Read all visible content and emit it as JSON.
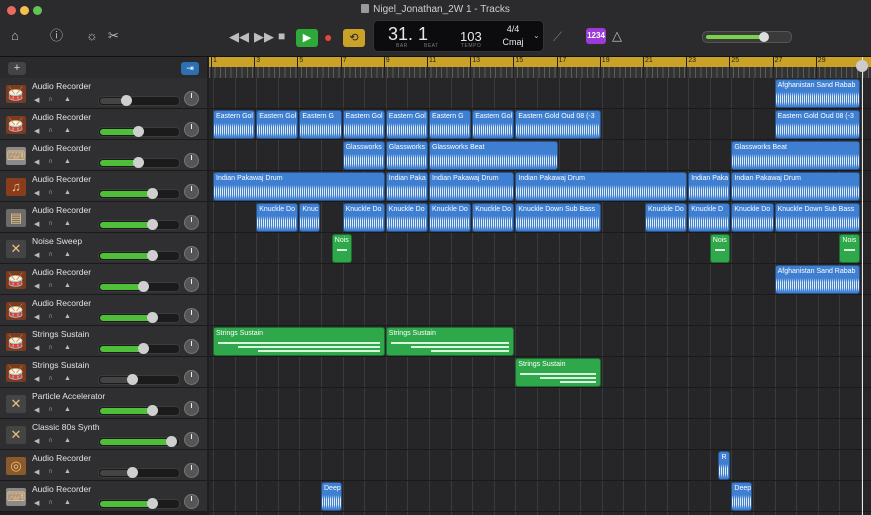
{
  "window": {
    "title": "Nigel_Jonathan_2W 1 - Tracks"
  },
  "toolbar": {
    "lcd": {
      "position": "31. 1",
      "bar_caption": "BAR",
      "beat_caption": "BEAT",
      "tempo": "103",
      "tempo_caption": "TEMPO",
      "time_signature": "4/4",
      "key": "Cmaj"
    },
    "count_in_badge": "1234"
  },
  "track_header": {
    "add_label": "+"
  },
  "ruler": {
    "bars": [
      "1",
      "3",
      "5",
      "7",
      "9",
      "11",
      "13",
      "15",
      "17",
      "19",
      "21",
      "23",
      "25",
      "27",
      "29"
    ]
  },
  "tracks": [
    {
      "name": "Audio Recorder",
      "icon": "drum-kit-icon",
      "volume": 0.35
    },
    {
      "name": "Audio Recorder",
      "icon": "drum-kit-icon",
      "volume": 0.5
    },
    {
      "name": "Audio Recorder",
      "icon": "keyboard-icon",
      "volume": 0.5
    },
    {
      "name": "Audio Recorder",
      "icon": "hand-drum-icon",
      "volume": 0.68
    },
    {
      "name": "Audio Recorder",
      "icon": "synth-keyboard-icon",
      "volume": 0.68
    },
    {
      "name": "Noise Sweep",
      "icon": "synth-stand-icon",
      "volume": 0.68
    },
    {
      "name": "Audio Recorder",
      "icon": "drum-kit-icon",
      "volume": 0.57
    },
    {
      "name": "Audio Recorder",
      "icon": "drum-kit-icon",
      "volume": 0.68
    },
    {
      "name": "Strings Sustain",
      "icon": "drum-kit-icon",
      "volume": 0.57
    },
    {
      "name": "Strings Sustain",
      "icon": "drum-kit-icon",
      "volume": 0.42
    },
    {
      "name": "Particle Accelerator",
      "icon": "synth-stand-icon",
      "volume": 0.68
    },
    {
      "name": "Classic 80s Synth",
      "icon": "synth-stand-icon",
      "volume": 0.92
    },
    {
      "name": "Audio Recorder",
      "icon": "snare-drum-icon",
      "volume": 0.42
    },
    {
      "name": "Audio Recorder",
      "icon": "keyboard-icon",
      "volume": 0.68
    }
  ],
  "regions": [
    {
      "row": 0,
      "start": 27,
      "end": 31,
      "type": "blue",
      "label": "Afghanistan Sand Rabab"
    },
    {
      "row": 1,
      "start": 1,
      "end": 3,
      "type": "blue",
      "label": "Eastern Gol"
    },
    {
      "row": 1,
      "start": 3,
      "end": 5,
      "type": "blue",
      "label": "Eastern Gol"
    },
    {
      "row": 1,
      "start": 5,
      "end": 7,
      "type": "blue",
      "label": "Eastern G"
    },
    {
      "row": 1,
      "start": 7,
      "end": 9,
      "type": "blue",
      "label": "Eastern Gol"
    },
    {
      "row": 1,
      "start": 9,
      "end": 11,
      "type": "blue",
      "label": "Eastern Gol"
    },
    {
      "row": 1,
      "start": 11,
      "end": 13,
      "type": "blue",
      "label": "Eastern G"
    },
    {
      "row": 1,
      "start": 13,
      "end": 15,
      "type": "blue",
      "label": "Eastern Gol"
    },
    {
      "row": 1,
      "start": 15,
      "end": 19,
      "type": "blue",
      "label": "Eastern Gold Oud 08 (-3"
    },
    {
      "row": 1,
      "start": 27,
      "end": 31,
      "type": "blue",
      "label": "Eastern Gold Oud 08 (-3"
    },
    {
      "row": 2,
      "start": 7,
      "end": 9,
      "type": "blue",
      "label": "Glassworks"
    },
    {
      "row": 2,
      "start": 9,
      "end": 11,
      "type": "blue",
      "label": "Glassworks"
    },
    {
      "row": 2,
      "start": 11,
      "end": 17,
      "type": "blue",
      "label": "Glassworks Beat"
    },
    {
      "row": 2,
      "start": 25,
      "end": 31,
      "type": "blue",
      "label": "Glassworks Beat"
    },
    {
      "row": 3,
      "start": 1,
      "end": 9,
      "type": "blue",
      "label": "Indian Pakawaj Drum"
    },
    {
      "row": 3,
      "start": 9,
      "end": 11,
      "type": "blue",
      "label": "Indian Paka"
    },
    {
      "row": 3,
      "start": 11,
      "end": 15,
      "type": "blue",
      "label": "Indian Pakawaj Drum"
    },
    {
      "row": 3,
      "start": 15,
      "end": 23,
      "type": "blue",
      "label": "Indian Pakawaj Drum"
    },
    {
      "row": 3,
      "start": 23,
      "end": 25,
      "type": "blue",
      "label": "Indian Paka"
    },
    {
      "row": 3,
      "start": 25,
      "end": 31,
      "type": "blue",
      "label": "Indian Pakawaj Drum"
    },
    {
      "row": 4,
      "start": 3,
      "end": 5,
      "type": "blue",
      "label": "Knuckle Do"
    },
    {
      "row": 4,
      "start": 5,
      "end": 6,
      "type": "blue",
      "label": "Knuc"
    },
    {
      "row": 4,
      "start": 7,
      "end": 9,
      "type": "blue",
      "label": "Knuckle Do"
    },
    {
      "row": 4,
      "start": 9,
      "end": 11,
      "type": "blue",
      "label": "Knuckle Do"
    },
    {
      "row": 4,
      "start": 11,
      "end": 13,
      "type": "blue",
      "label": "Knuckle Do"
    },
    {
      "row": 4,
      "start": 13,
      "end": 15,
      "type": "blue",
      "label": "Knuckle Do"
    },
    {
      "row": 4,
      "start": 15,
      "end": 19,
      "type": "blue",
      "label": "Knuckle Down Sub Bass"
    },
    {
      "row": 4,
      "start": 21,
      "end": 23,
      "type": "blue",
      "label": "Knuckle Do"
    },
    {
      "row": 4,
      "start": 23,
      "end": 25,
      "type": "blue",
      "label": "Knuckle D"
    },
    {
      "row": 4,
      "start": 25,
      "end": 27,
      "type": "blue",
      "label": "Knuckle Do"
    },
    {
      "row": 4,
      "start": 27,
      "end": 31,
      "type": "blue",
      "label": "Knuckle Down Sub Bass"
    },
    {
      "row": 5,
      "start": 6.5,
      "end": 7.5,
      "type": "green",
      "label": "Nois"
    },
    {
      "row": 5,
      "start": 24,
      "end": 25,
      "type": "green",
      "label": "Nois"
    },
    {
      "row": 5,
      "start": 30,
      "end": 31,
      "type": "green",
      "label": "Nois"
    },
    {
      "row": 6,
      "start": 27,
      "end": 31,
      "type": "blue",
      "label": "Afghanistan Sand Rabab"
    },
    {
      "row": 8,
      "start": 1,
      "end": 9,
      "type": "green",
      "label": "Strings Sustain"
    },
    {
      "row": 8,
      "start": 9,
      "end": 15,
      "type": "green",
      "label": "Strings Sustain"
    },
    {
      "row": 9,
      "start": 15,
      "end": 19,
      "type": "green",
      "label": "Strings Sustain"
    },
    {
      "row": 12,
      "start": 24.4,
      "end": 25,
      "type": "blue",
      "label": "R"
    },
    {
      "row": 13,
      "start": 6,
      "end": 7,
      "type": "blue",
      "label": "Deep"
    },
    {
      "row": 13,
      "start": 25,
      "end": 26,
      "type": "blue",
      "label": "Deep"
    }
  ],
  "colors": {
    "audio_region": "#3f7fd1",
    "midi_region": "#2ea84a",
    "cycle": "#c9a227",
    "play": "#2fa83a",
    "record": "#e2463c"
  }
}
